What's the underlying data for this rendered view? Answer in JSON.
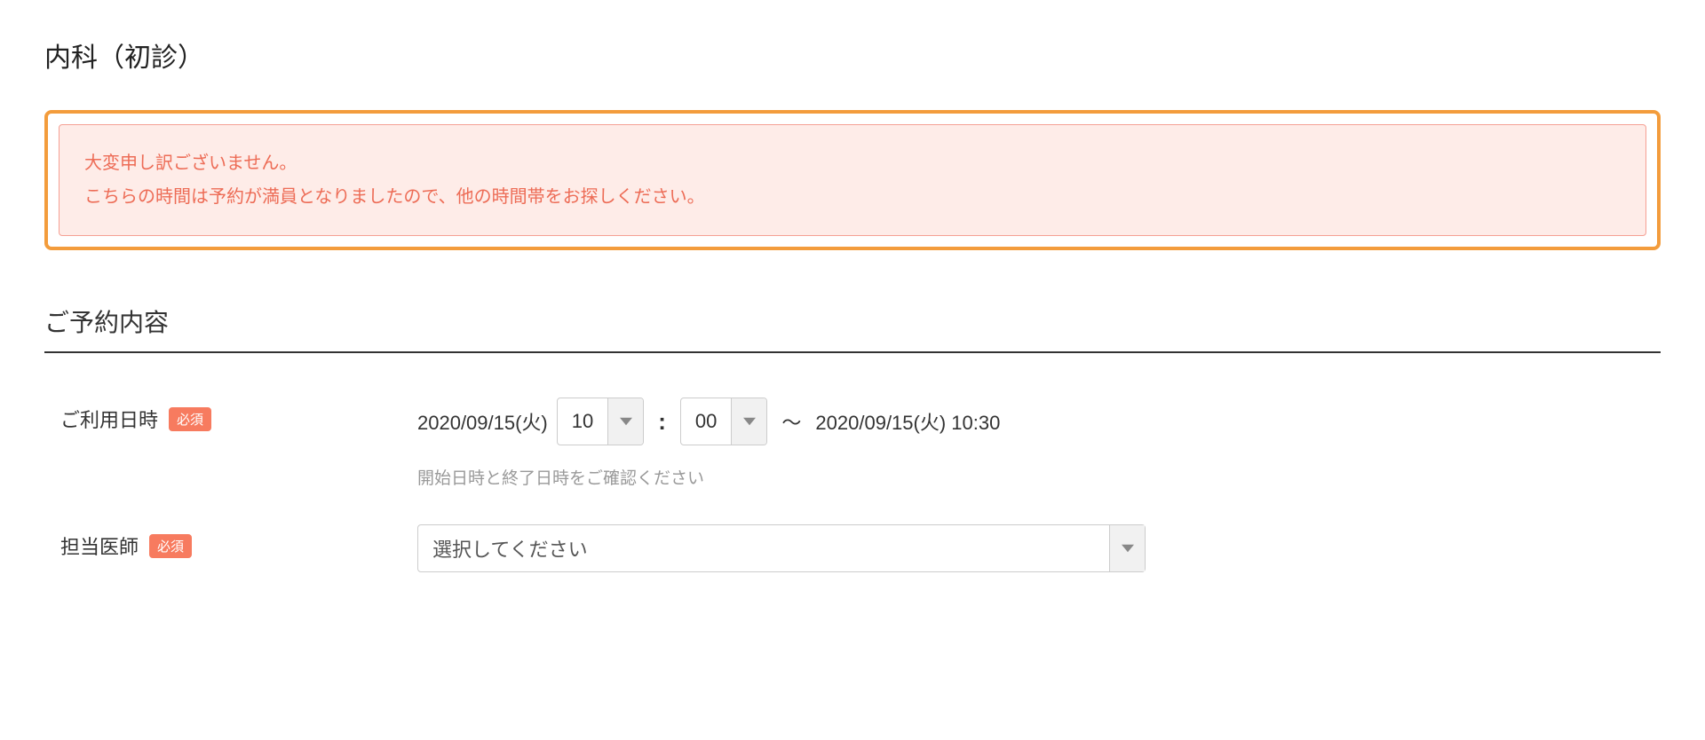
{
  "page_title": "内科（初診）",
  "alert": {
    "line1": "大変申し訳ございません。",
    "line2": "こちらの時間は予約が満員となりましたので、他の時間帯をお探しください。"
  },
  "section_title": "ご予約内容",
  "required_label": "必須",
  "fields": {
    "datetime": {
      "label": "ご利用日時",
      "start_date": "2020/09/15(火)",
      "hour": "10",
      "minute": "00",
      "end_text": "2020/09/15(火) 10:30",
      "tilde": "〜",
      "helper": "開始日時と終了日時をご確認ください"
    },
    "doctor": {
      "label": "担当医師",
      "placeholder": "選択してください"
    }
  }
}
